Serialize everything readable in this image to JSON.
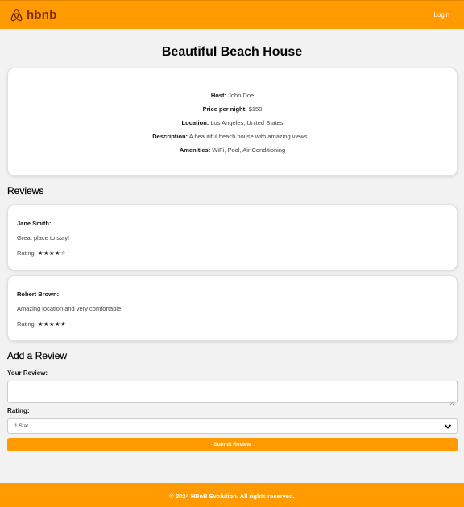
{
  "header": {
    "logo_text": "hbnb",
    "logo_icon": "airbnb-logo-icon",
    "login_label": "Login"
  },
  "place": {
    "title": "Beautiful Beach House",
    "host_label": "Host:",
    "host": "John Doe",
    "price_label": "Price per night:",
    "price": "$150",
    "location_label": "Location:",
    "location": "Los Angeles, United States",
    "description_label": "Description:",
    "description": "A beautiful beach house with amazing views...",
    "amenities_label": "Amenities:",
    "amenities": "WiFi, Pool, Air Conditioning"
  },
  "reviews": {
    "title": "Reviews",
    "items": [
      {
        "author": "Jane Smith:",
        "comment": "Great place to stay!",
        "rating_label": "Rating:",
        "stars": "★★★★☆",
        "rating_value": 4
      },
      {
        "author": "Robert Brown:",
        "comment": "Amazing location and very comfortable.",
        "rating_label": "Rating:",
        "stars": "★★★★★",
        "rating_value": 5
      }
    ]
  },
  "add_review": {
    "title": "Add a Review",
    "review_label": "Your Review:",
    "review_value": "",
    "rating_label": "Rating:",
    "rating_selected": "1 Star",
    "submit_label": "Submit Review"
  },
  "footer": {
    "text": "© 2024 HBnB Evolution. All rights reserved."
  },
  "colors": {
    "accent": "#ff9a00",
    "logo_text": "#7a2f16",
    "background": "#f2f2f2"
  }
}
